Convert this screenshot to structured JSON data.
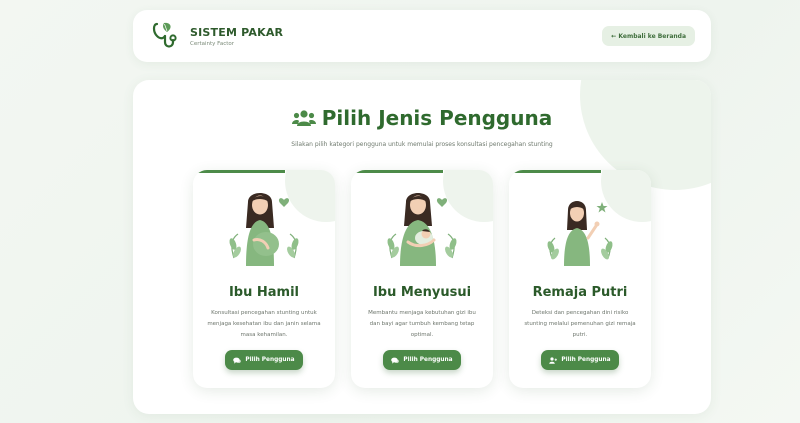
{
  "header": {
    "brand_title": "SISTEM PAKAR",
    "brand_subtitle": "Certainty Factor",
    "back_label": "← Kembali ke Beranda"
  },
  "main": {
    "title": "Pilih Jenis Pengguna",
    "subtitle": "Silakan pilih kategori pengguna untuk memulai proses konsultasi pencegahan stunting",
    "title_icon": "users-icon"
  },
  "cards": [
    {
      "title": "Ibu Hamil",
      "desc": "Konsultasi pencegahan stunting untuk menjaga kesehatan ibu dan janin selama masa kehamilan.",
      "button": "Pilih Pengguna",
      "button_icon": "chat-icon",
      "illustration": "pregnant-woman-illustration"
    },
    {
      "title": "Ibu Menyusui",
      "desc": "Membantu menjaga kebutuhan gizi ibu dan bayi agar tumbuh kembang tetap optimal.",
      "button": "Pilih Pengguna",
      "button_icon": "chat-icon",
      "illustration": "breastfeeding-mother-illustration"
    },
    {
      "title": "Remaja Putri",
      "desc": "Deteksi dan pencegahan dini risiko stunting melalui pemenuhan gizi remaja putri.",
      "button": "Pilih Pengguna",
      "button_icon": "user-plus-icon",
      "illustration": "teenage-girl-illustration"
    }
  ],
  "colors": {
    "primary": "#4c8a48",
    "title": "#2f6a2e",
    "background": "#f1f6f0"
  }
}
